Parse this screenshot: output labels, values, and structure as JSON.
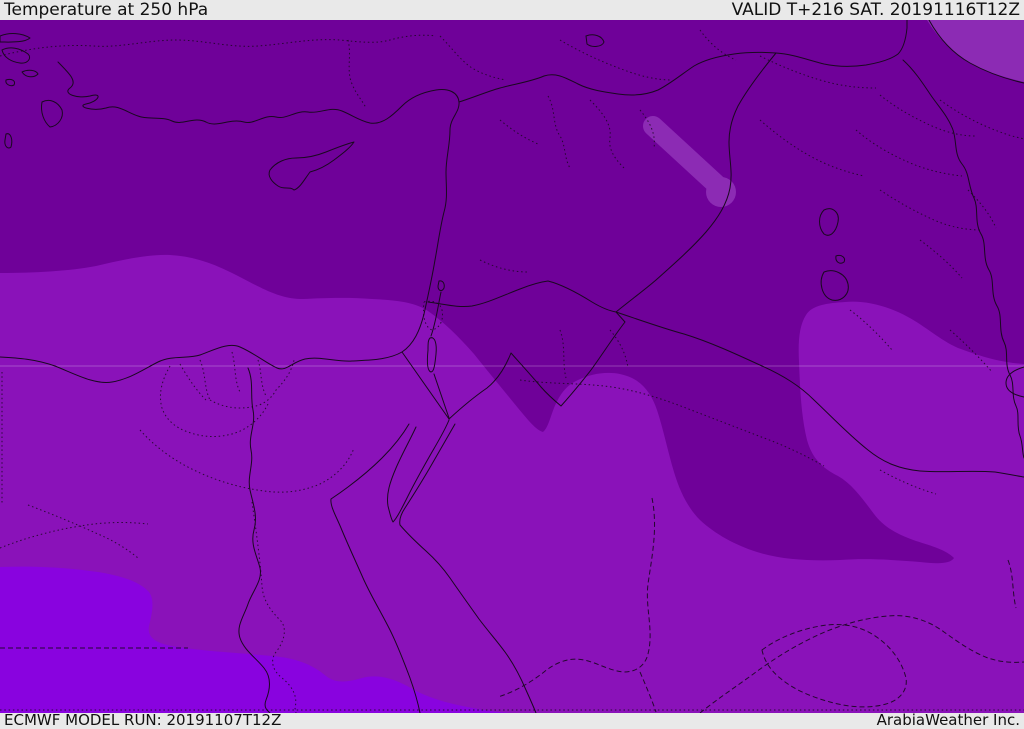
{
  "header": {
    "title": "Temperature at 250 hPa",
    "valid_label": "VALID T+216 SAT. 20191116T12Z"
  },
  "footer": {
    "model_run": "ECMWF MODEL RUN: 20191107T12Z",
    "credit": "ArabiaWeather Inc."
  },
  "map": {
    "type": "weather-temperature-shading-map",
    "region": "Eastern Mediterranean / Middle East (Turkey, Cyprus, Levant, Egypt, Saudi Arabia, Iraq)",
    "colors": {
      "bar_bg": "#E9E9E9",
      "bar_text": "#111111",
      "zone_dark": "#6F0199",
      "zone_medium": "#8A12B9",
      "zone_bright": "#8903DF",
      "zone_accent": "#8C2BB4",
      "border_line": "#1A0820",
      "gridline_light": "rgba(255,255,255,0.25)"
    },
    "zones": [
      {
        "name": "dark-purple-zone",
        "color": "#6F0199",
        "coverage": "northern band over Turkey, Syria, Iraq and north Jordan, with a tongue extending south into central Saudi Arabia and a lobe over south-central Saudi Arabia"
      },
      {
        "name": "medium-purple-zone",
        "color": "#8A12B9",
        "coverage": "Egypt, Sinai, northwest Saudi Arabia and eastern Arabia"
      },
      {
        "name": "bright-violet-zone",
        "color": "#8903DF",
        "coverage": "southwest corner over southern Egypt / northeast Libya / Sudan border area"
      },
      {
        "name": "light-purple-patches",
        "color": "#8C2BB4",
        "coverage": "elongated streak over eastern Syria and a patch in the far northeast corner"
      }
    ]
  }
}
